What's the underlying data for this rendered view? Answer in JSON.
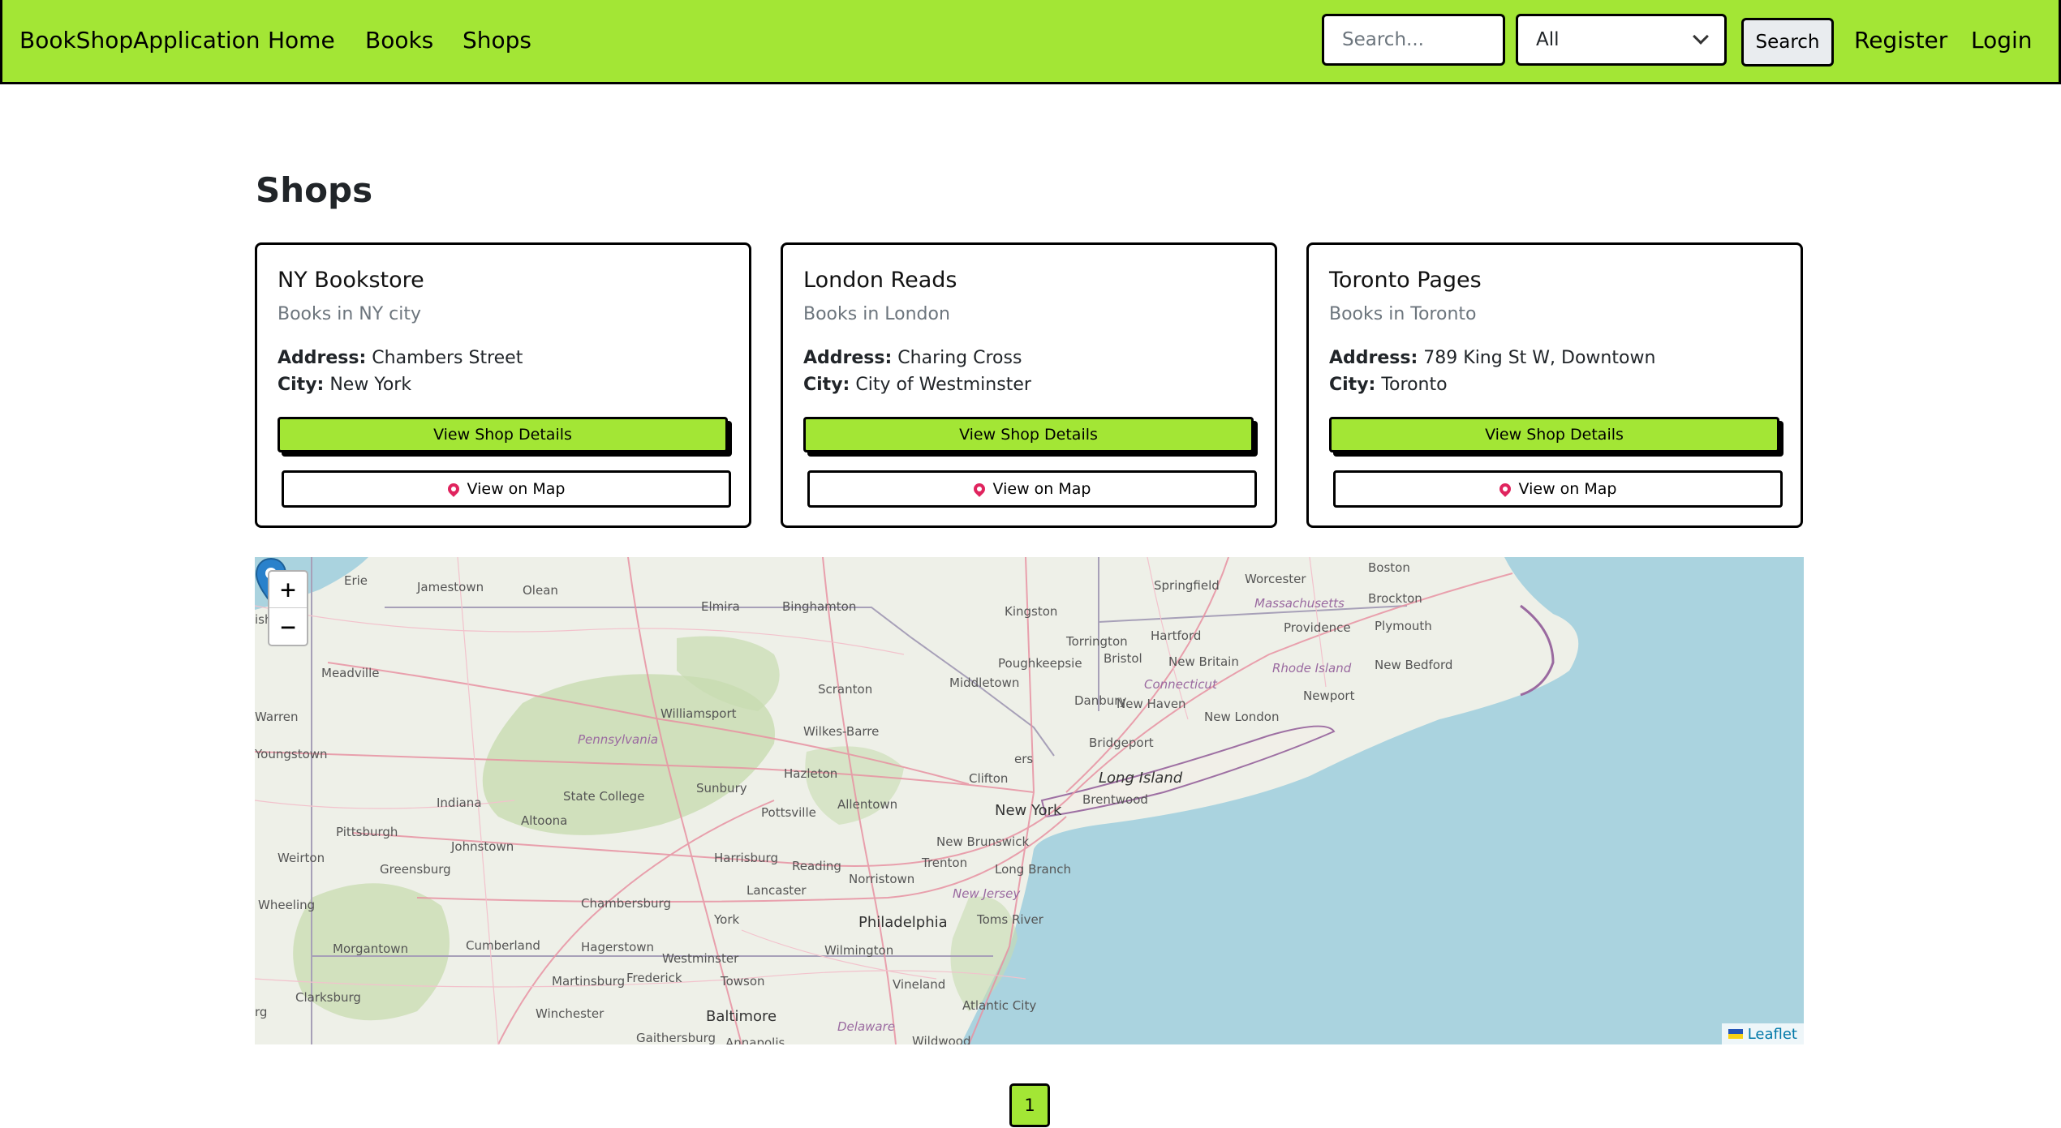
{
  "navbar": {
    "brand": "BookShopApplication",
    "links": [
      "Home",
      "Books",
      "Shops"
    ],
    "search_placeholder": "Search...",
    "filter_selected": "All",
    "search_button": "Search",
    "register": "Register",
    "login": "Login",
    "bg_color": "#a3e635"
  },
  "page": {
    "title": "Shops"
  },
  "shops": [
    {
      "name": "NY Bookstore",
      "description": "Books in NY city",
      "address_label": "Address:",
      "address": "Chambers Street",
      "city_label": "City:",
      "city": "New York",
      "details_button": "View Shop Details",
      "map_button": "View on Map"
    },
    {
      "name": "London Reads",
      "description": "Books in London",
      "address_label": "Address:",
      "address": "Charing Cross",
      "city_label": "City:",
      "city": "City of Westminster",
      "details_button": "View Shop Details",
      "map_button": "View on Map"
    },
    {
      "name": "Toronto Pages",
      "description": "Books in Toronto",
      "address_label": "Address:",
      "address": "789 King St W, Downtown",
      "city_label": "City:",
      "city": "Toronto",
      "details_button": "View Shop Details",
      "map_button": "View on Map"
    }
  ],
  "map": {
    "zoom_in": "+",
    "zoom_out": "−",
    "attribution": "Leaflet",
    "labels": {
      "erie": "Erie",
      "jamestown": "Jamestown",
      "olean": "Olean",
      "elmira": "Elmira",
      "binghamton": "Binghamton",
      "kingston": "Kingston",
      "springfield": "Springfield",
      "worcester": "Worcester",
      "boston": "Boston",
      "massachusetts": "Massachusetts",
      "brockton": "Brockton",
      "plymouth": "Plymouth",
      "hartford": "Hartford",
      "torrington": "Torrington",
      "providence": "Providence",
      "poughkeepsie": "Poughkeepsie",
      "bristol": "Bristol",
      "new_britain": "New Britain",
      "rhode_island": "Rhode Island",
      "new_bedford": "New Bedford",
      "meadville": "Meadville",
      "middletown": "Middletown",
      "connecticut": "Connecticut",
      "scranton": "Scranton",
      "danbury": "Danbury",
      "newport": "Newport",
      "williamsport": "Williamsport",
      "new_haven": "New Haven",
      "new_london": "New London",
      "warren": "Warren",
      "wilkes_barre": "Wilkes-Barre",
      "pennsylvania": "Pennsylvania",
      "bridgeport": "Bridgeport",
      "youngstown": "Youngstown",
      "hazleton": "Hazleton",
      "clifton": "Clifton",
      "long_island": "Long Island",
      "state_college": "State College",
      "sunbury": "Sunbury",
      "allentown": "Allentown",
      "brentwood": "Brentwood",
      "indiana": "Indiana",
      "pottsville": "Pottsville",
      "new_york": "New York",
      "altoona": "Altoona",
      "pittsburgh": "Pittsburgh",
      "new_brunswick": "New Brunswick",
      "johnstown": "Johnstown",
      "harrisburg": "Harrisburg",
      "weirton": "Weirton",
      "reading": "Reading",
      "trenton": "Trenton",
      "greensburg": "Greensburg",
      "norristown": "Norristown",
      "long_branch": "Long Branch",
      "lancaster": "Lancaster",
      "new_jersey": "New Jersey",
      "wheeling": "Wheeling",
      "chambersburg": "Chambersburg",
      "york": "York",
      "philadelphia": "Philadelphia",
      "toms_river": "Toms River",
      "morgantown": "Morgantown",
      "cumberland": "Cumberland",
      "hagerstown": "Hagerstown",
      "wilmington": "Wilmington",
      "westminster": "Westminster",
      "martinsburg": "Martinsburg",
      "frederick": "Frederick",
      "towson": "Towson",
      "vineland": "Vineland",
      "clarksburg": "Clarksburg",
      "winchester": "Winchester",
      "baltimore": "Baltimore",
      "atlantic_city": "Atlantic City",
      "delaware": "Delaware",
      "gaithersburg": "Gaithersburg",
      "annapolis": "Annapolis",
      "wildwood": "Wildwood",
      "ers": "ers",
      "ish": "ish",
      "rg": "rg"
    }
  },
  "pagination": {
    "current": "1"
  }
}
